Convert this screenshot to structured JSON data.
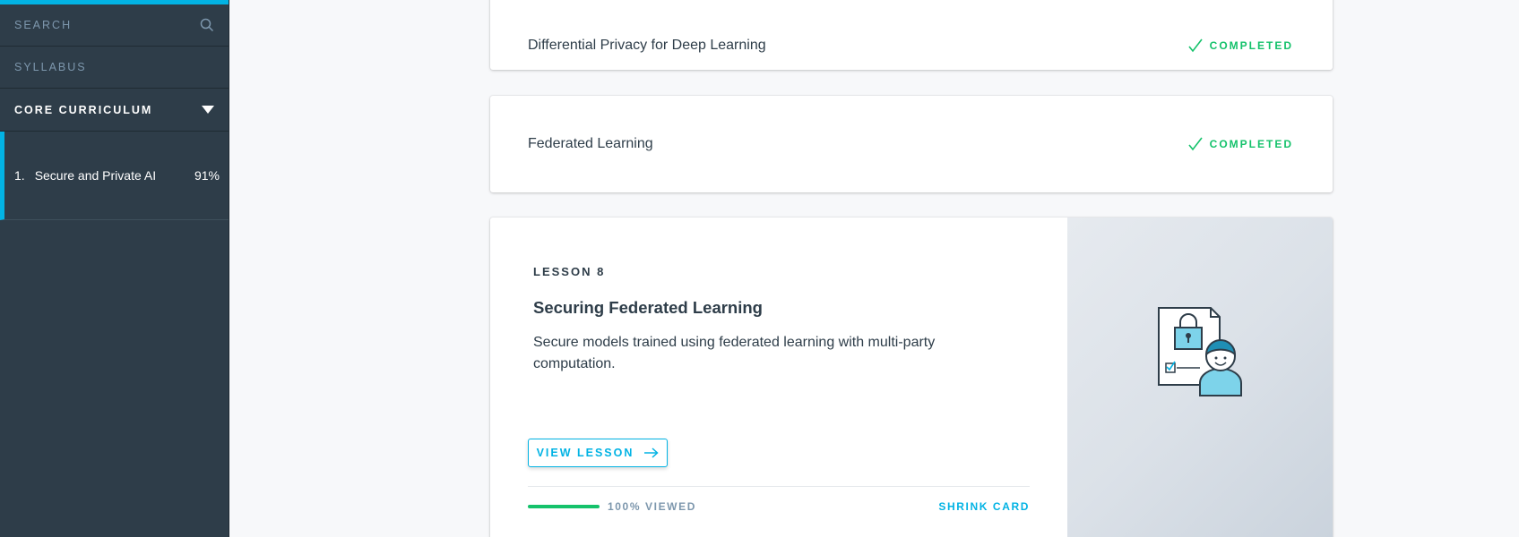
{
  "sidebar": {
    "search_label": "SEARCH",
    "syllabus_label": "SYLLABUS",
    "section_label": "CORE CURRICULUM",
    "lesson": {
      "number": "1.",
      "title": "Secure and Private AI",
      "progress": "91%"
    }
  },
  "cards": [
    {
      "title": "Differential Privacy for Deep Learning",
      "status": "COMPLETED"
    },
    {
      "title": "Federated Learning",
      "status": "COMPLETED"
    }
  ],
  "lesson_card": {
    "label": "LESSON 8",
    "title": "Securing Federated Learning",
    "description": "Secure models trained using federated learning with multi-party computation.",
    "button_label": "VIEW LESSON",
    "progress_fraction": 1.0,
    "viewed_text": "100% VIEWED",
    "shrink_label": "SHRINK CARD"
  },
  "colors": {
    "accent": "#02b3e4",
    "success": "#15c26b",
    "sidebar_bg": "#2e3d49"
  },
  "icons": [
    "search-icon",
    "caret-down-icon",
    "checkmark-icon",
    "arrow-right-icon",
    "secure-document-user-illustration"
  ]
}
